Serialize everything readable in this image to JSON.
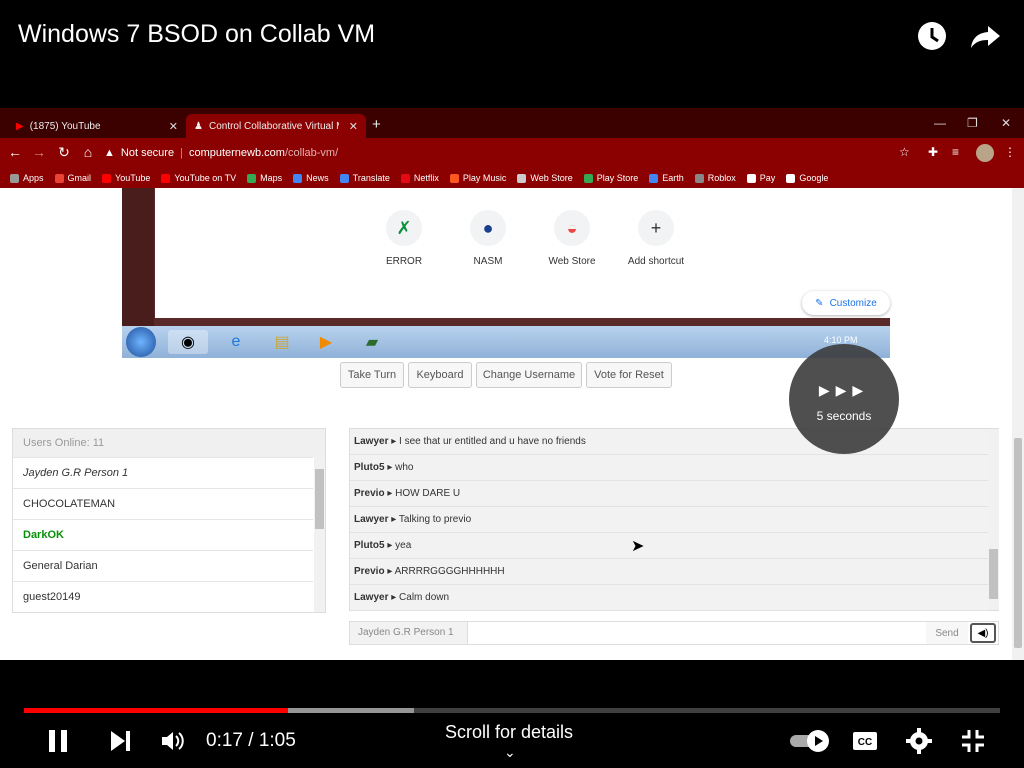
{
  "video": {
    "title": "Windows 7 BSOD on Collab VM",
    "time_display": "0:17 / 1:05",
    "progress": 0.27,
    "buffered": 0.4,
    "scroll_hint": "Scroll for details",
    "autoplay_countdown": "5 seconds"
  },
  "browser": {
    "tabs": [
      {
        "label": "(1875) YouTube",
        "icon": "youtube-icon"
      },
      {
        "label": "Control Collaborative Virtual Ma...",
        "icon": "collabvm-icon"
      }
    ],
    "security_label": "Not secure",
    "url_host": "computernewb.com",
    "url_path": "/collab-vm/",
    "bookmarks": [
      "Apps",
      "Gmail",
      "YouTube",
      "YouTube on TV",
      "Maps",
      "News",
      "Translate",
      "Netflix",
      "Play Music",
      "Web Store",
      "Play Store",
      "Earth",
      "Roblox",
      "Pay",
      "Google"
    ]
  },
  "vm": {
    "shortcuts": [
      "ERROR",
      "NASM",
      "Web Store",
      "Add shortcut"
    ],
    "customize": "Customize",
    "clock": "4:10 PM",
    "buttons": [
      "Take Turn",
      "Keyboard",
      "Change Username",
      "Vote for Reset"
    ]
  },
  "users": {
    "header": "Users Online: 11",
    "list": [
      "Jayden G.R Person 1",
      "CHOCOLATEMAN",
      "DarkOK",
      "General Darian",
      "guest20149"
    ]
  },
  "chat": {
    "messages": [
      {
        "user": "Lawyer",
        "text": "I see that ur entitled and u have no friends"
      },
      {
        "user": "Pluto5",
        "text": "who"
      },
      {
        "user": "Previo",
        "text": "HOW DARE U"
      },
      {
        "user": "Lawyer",
        "text": "Talking to previo"
      },
      {
        "user": "Pluto5",
        "text": "yea"
      },
      {
        "user": "Previo",
        "text": "ARRRRGGGGHHHHHH"
      },
      {
        "user": "Lawyer",
        "text": "Calm down"
      }
    ],
    "username": "Jayden G.R Person 1",
    "send": "Send"
  },
  "colors": {
    "accent": "#ff0000",
    "browser_frame": "#8b0000",
    "admin_user": "#0a8f0a"
  }
}
